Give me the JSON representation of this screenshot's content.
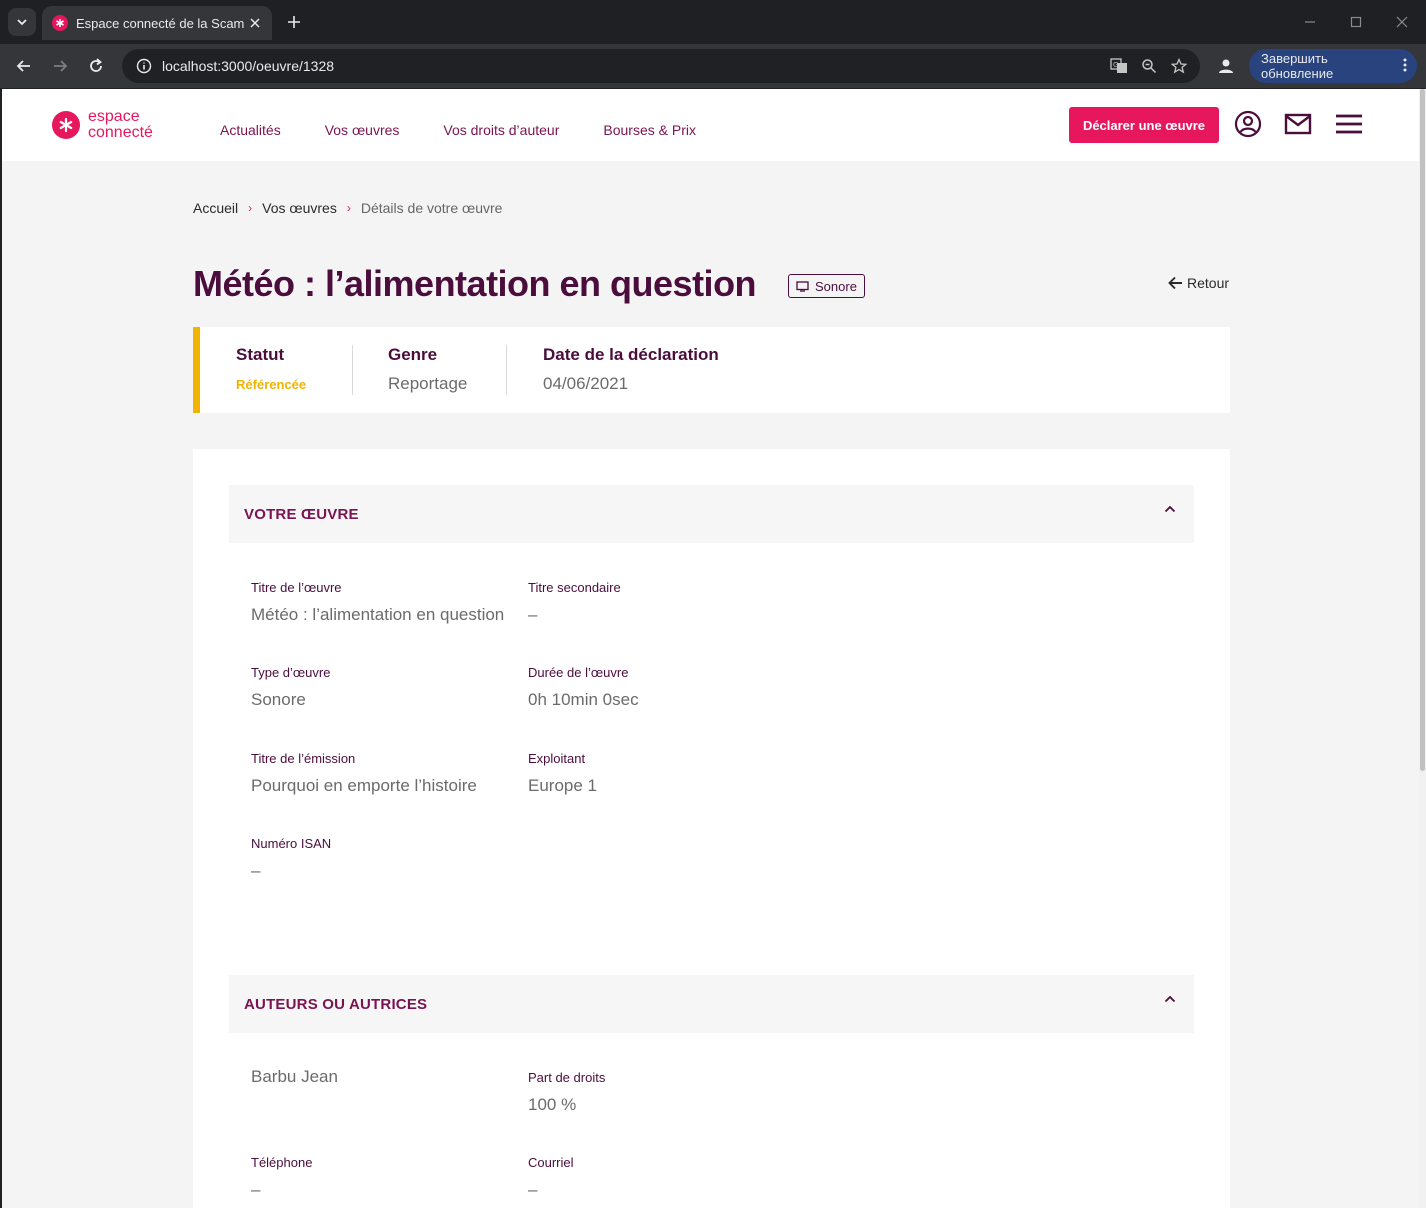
{
  "browser": {
    "tab_title": "Espace connecté de la Scam",
    "url": "localhost:3000/oeuvre/1328",
    "update_label": "Завершить обновление"
  },
  "header": {
    "logo_line1": "espace",
    "logo_line2": "connecté",
    "nav": [
      "Actualités",
      "Vos œuvres",
      "Vos droits d’auteur",
      "Bourses & Prix"
    ],
    "declare_label": "Déclarer une œuvre"
  },
  "breadcrumb": {
    "items": [
      "Accueil",
      "Vos œuvres"
    ],
    "current": "Détails de votre œuvre"
  },
  "page": {
    "title": "Météo : l’alimentation en question",
    "type_badge": "Sonore",
    "back_label": "Retour"
  },
  "status": {
    "statut_label": "Statut",
    "statut_value": "Référencée",
    "genre_label": "Genre",
    "genre_value": "Reportage",
    "date_label": "Date de la déclaration",
    "date_value": "04/06/2021",
    "accent_color": "#f0b400"
  },
  "oeuvre_section": {
    "heading": "VOTRE ŒUVRE",
    "fields": [
      {
        "label": "Titre de l’œuvre",
        "value": "Météo : l’alimentation en question"
      },
      {
        "label": "Titre secondaire",
        "value": "–"
      },
      {
        "label": "Type d’œuvre",
        "value": "Sonore"
      },
      {
        "label": "Durée de l’œuvre",
        "value": "0h 10min 0sec"
      },
      {
        "label": "Titre de l’émission",
        "value": "Pourquoi en emporte l’histoire"
      },
      {
        "label": "Exploitant",
        "value": "Europe 1"
      },
      {
        "label": "Numéro ISAN",
        "value": "–"
      }
    ]
  },
  "auteurs_section": {
    "heading": "AUTEURS OU AUTRICES",
    "author_name": "Barbu Jean",
    "fields": [
      {
        "label": "Part de droits",
        "value": "100 %"
      },
      {
        "label": "Téléphone",
        "value": "–"
      },
      {
        "label": "Courriel",
        "value": "–"
      }
    ]
  },
  "colors": {
    "brand_pink": "#e6175c",
    "plum": "#4a0d3c",
    "nav_plum": "#7a1451"
  }
}
